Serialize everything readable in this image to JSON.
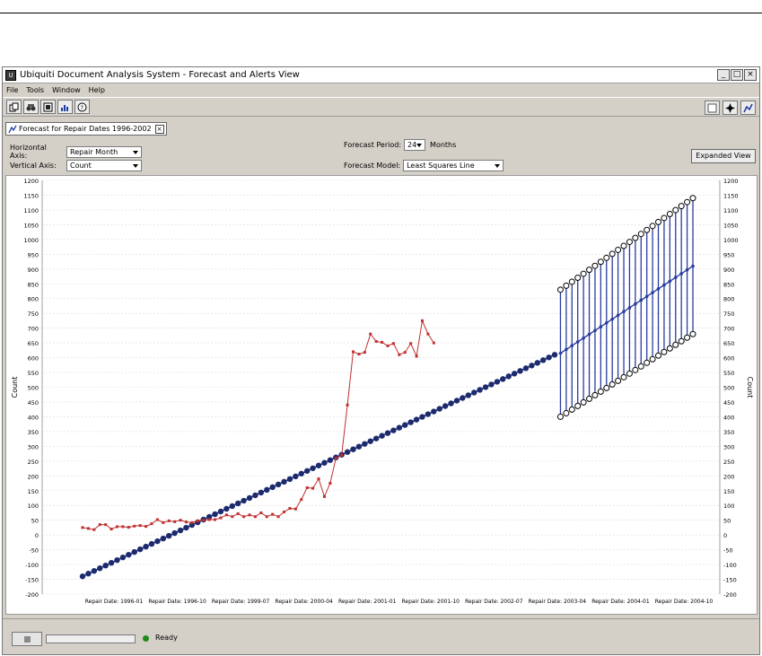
{
  "window": {
    "title": "Ubiquiti Document Analysis System - Forecast and Alerts View",
    "app_icon": "chart-app-icon"
  },
  "menu": {
    "items": [
      "File",
      "Tools",
      "Window",
      "Help"
    ]
  },
  "tab": {
    "label": "Forecast for Repair Dates 1996-2002"
  },
  "controls": {
    "h_axis_label": "Horizontal Axis:",
    "h_axis_value": "Repair Month",
    "v_axis_label": "Vertical Axis:",
    "v_axis_value": "Count",
    "period_label": "Forecast Period:",
    "period_value": "24",
    "period_unit": "Months",
    "model_label": "Forecast Model:",
    "model_value": "Least Squares Line",
    "expanded_button": "Expanded View"
  },
  "status": {
    "text": "Ready",
    "progress": 0,
    "indicator_color": "#1e8a1e"
  },
  "chart_data": {
    "type": "line",
    "ylabel": "Count",
    "ylim": [
      -200,
      1200
    ],
    "yticks": [
      -200,
      -150,
      -100,
      -50,
      0,
      50,
      100,
      150,
      200,
      250,
      300,
      350,
      400,
      450,
      500,
      550,
      600,
      650,
      700,
      750,
      800,
      850,
      900,
      950,
      1000,
      1050,
      1100,
      1150,
      1200
    ],
    "x_tick_labels": [
      "Repair Date: 1996-01",
      "Repair Date: 1996-10",
      "Repair Date: 1999-07",
      "Repair Date: 2000-04",
      "Repair Date: 2001-01",
      "Repair Date: 2001-10",
      "Repair Date: 2002-07",
      "Repair Date: 2003-04",
      "Repair Date: 2004-01",
      "Repair Date: 2004-10"
    ],
    "grid": true,
    "colors": {
      "actual": "#c03030",
      "trend": "#1c2a6e",
      "forecast": "#2a3c9e"
    },
    "series": [
      {
        "role": "actual",
        "values": [
          25,
          22,
          18,
          35,
          35,
          20,
          28,
          28,
          26,
          30,
          32,
          29,
          38,
          52,
          42,
          48,
          45,
          50,
          44,
          42,
          48,
          50,
          52,
          52,
          58,
          68,
          62,
          72,
          62,
          68,
          62,
          75,
          62,
          70,
          62,
          78,
          90,
          88,
          120,
          160,
          158,
          190,
          130,
          175,
          260,
          270,
          440,
          620,
          612,
          618,
          680,
          655,
          652,
          640,
          648,
          610,
          618,
          648,
          605,
          725,
          680,
          650
        ]
      },
      {
        "role": "trend",
        "start": -140,
        "end": 610,
        "count": 83
      },
      {
        "role": "forecast",
        "start_center": 615,
        "end_center": 910,
        "start_upper": 830,
        "end_upper": 1140,
        "start_lower": 400,
        "end_lower": 680,
        "count": 24
      }
    ]
  }
}
